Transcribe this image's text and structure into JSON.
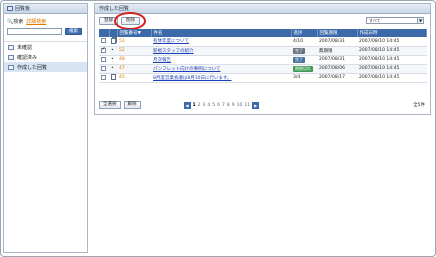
{
  "sidebar": {
    "title": "回覧板",
    "search_label": "検索",
    "advanced_search": "詳細検索",
    "search_button": "検索",
    "folders": [
      {
        "label": "未確認",
        "selected": false
      },
      {
        "label": "確認済み",
        "selected": false
      },
      {
        "label": "作成した回覧",
        "selected": true
      }
    ]
  },
  "main": {
    "title": "作成した回覧",
    "toolbar": {
      "register": "登録",
      "delete": "削除"
    },
    "filter_value": "すべて",
    "columns": [
      "",
      "",
      "回覧番号",
      "件名",
      "進捗",
      "回覧期限",
      "作成日時"
    ],
    "rows": [
      {
        "checked": false,
        "num": "53",
        "title": "有休年度について",
        "progress": "4/10",
        "badge": "",
        "deadline": "2007/08/31",
        "created": "2007/08/10 14:45",
        "icon": "multi"
      },
      {
        "checked": true,
        "num": "52",
        "title": "新規スタッフの紹介",
        "progress": "",
        "badge": "完了",
        "badge_color": "gray",
        "deadline": "無期限",
        "created": "2007/08/10 14:45",
        "icon": "single"
      },
      {
        "checked": false,
        "num": "48",
        "title": "月次報告",
        "progress": "",
        "badge": "完了",
        "badge_color": "blue",
        "deadline": "2007/08/31",
        "created": "2007/08/10 14:45",
        "icon": "single"
      },
      {
        "checked": false,
        "num": "47",
        "title": "パンフレット向けの事例について",
        "progress": "",
        "badge": "期限切れ",
        "badge_color": "green",
        "deadline": "2007/08/06",
        "created": "2007/08/10 14:45",
        "icon": "single"
      },
      {
        "checked": false,
        "num": "45",
        "title": "8月度営業会議は8月30日に行います。",
        "progress": "3/4",
        "badge": "",
        "deadline": "2007/08/17",
        "created": "2007/08/10 14:45",
        "icon": "single"
      }
    ],
    "bottom": {
      "select_all": "全選択",
      "clear": "解除",
      "pages": [
        "1",
        "2",
        "3",
        "4",
        "5",
        "6",
        "7",
        "8",
        "9",
        "10",
        "11"
      ],
      "current_page": "1",
      "prev": "◀",
      "next": "▶",
      "total": "全5件"
    }
  },
  "colors": {
    "header_blue": "#3c69a8",
    "link": "#1a3fb5",
    "highlight_ring": "#d22020"
  }
}
